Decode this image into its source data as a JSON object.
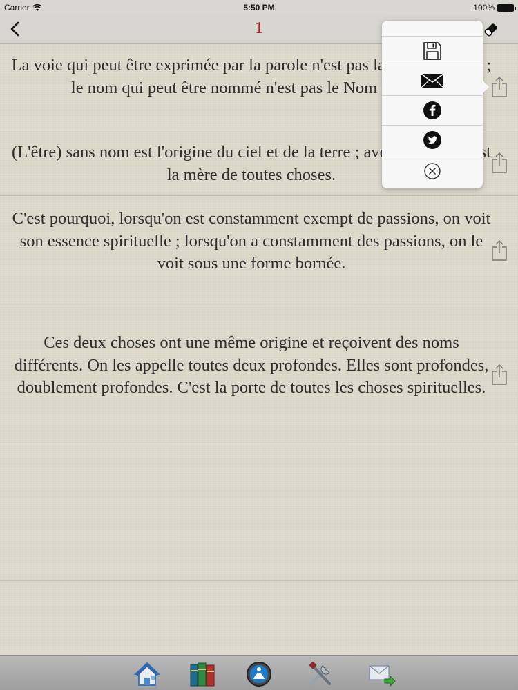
{
  "status_bar": {
    "carrier": "Carrier",
    "time": "5:50 PM",
    "battery": "100%"
  },
  "nav": {
    "title": "1",
    "back_icon": "chevron-left-icon",
    "action_icon": "eraser-icon"
  },
  "verses": [
    {
      "text": "La voie qui peut être exprimée par la parole n'est pas la Voie éternelle ; le nom qui peut être nommé n'est pas le Nom éternel."
    },
    {
      "text": "(L'être) sans nom est l'origine du ciel et de la terre ; avec un nom, il est la mère de toutes choses."
    },
    {
      "text": "C'est pourquoi, lorsqu'on est constamment exempt de passions, on voit son essence spirituelle ; lorsqu'on a constamment des passions, on le voit sous une forme bornée."
    },
    {
      "text": "Ces deux choses ont une même origine et reçoivent des noms différents. On les appelle toutes deux profondes. Elles sont profondes, doublement profondes. C'est la porte de toutes les choses spirituelles."
    }
  ],
  "share_menu": {
    "items": [
      "save-icon",
      "mail-icon",
      "facebook-icon",
      "twitter-icon",
      "close-circle-icon"
    ]
  },
  "tab_bar": {
    "items": [
      "home-icon",
      "books-icon",
      "meditation-icon",
      "tools-icon",
      "mail-send-icon"
    ]
  },
  "colors": {
    "title": "#c0161b",
    "text": "#2e2e2e",
    "background": "#dcd8ca"
  }
}
